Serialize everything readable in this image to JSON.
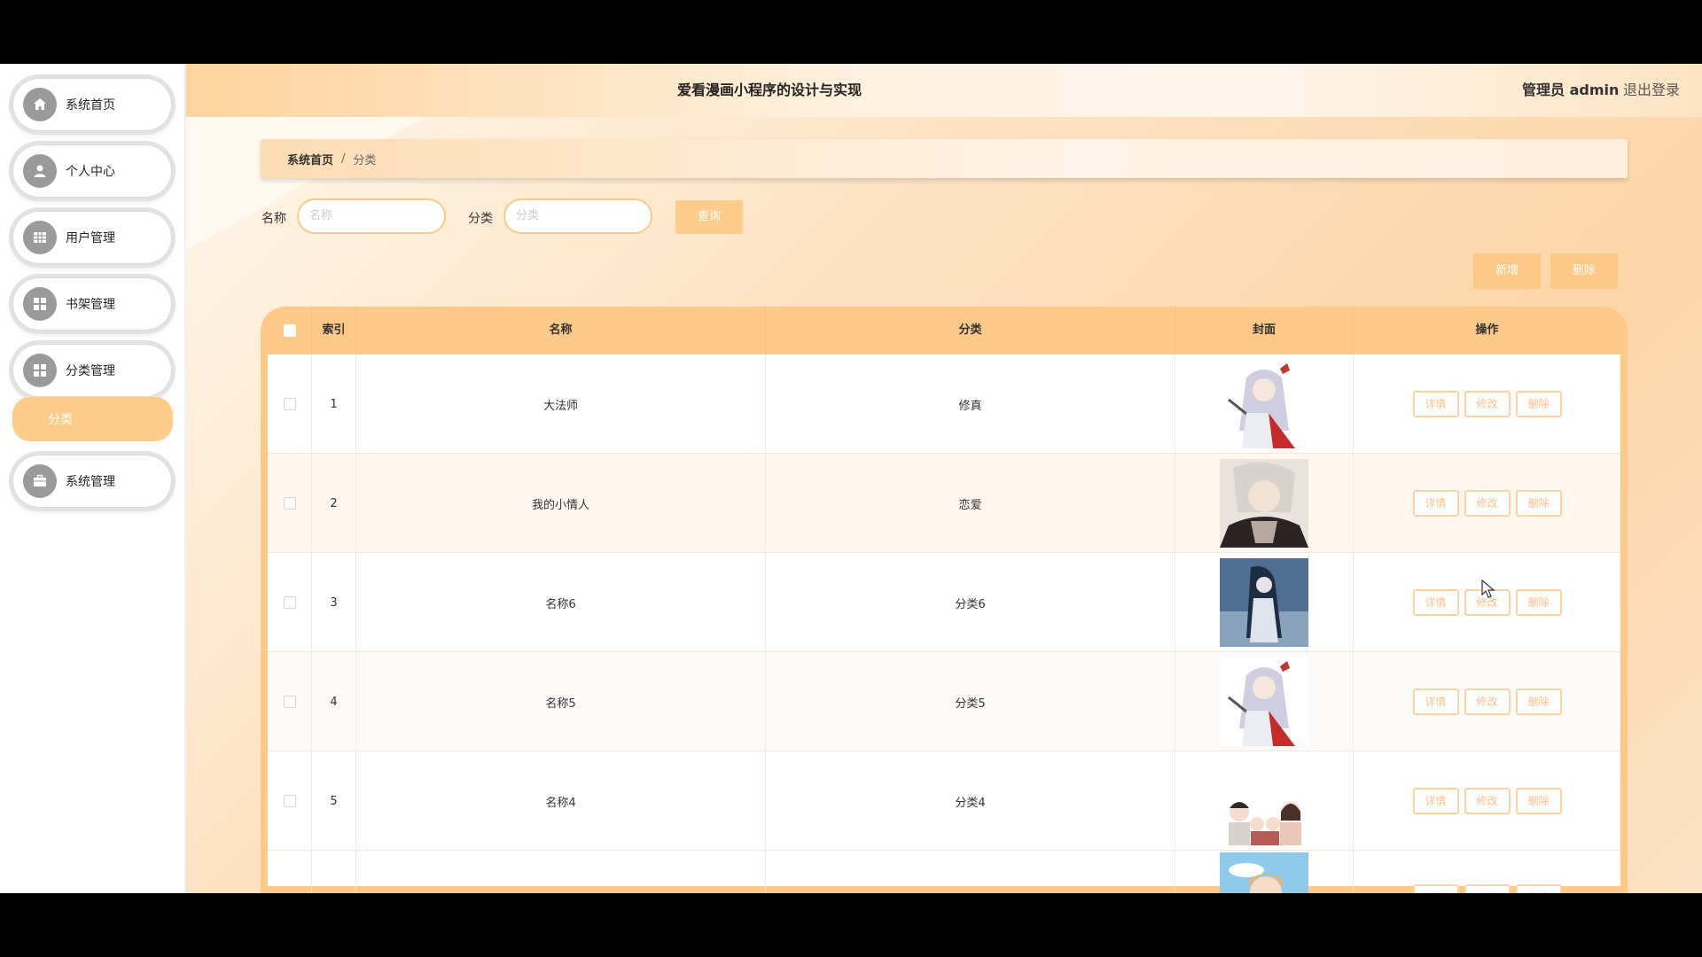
{
  "app": {
    "title": "爱看漫画小程序的设计与实现",
    "admin_label": "管理员 admin",
    "logout_label": "退出登录"
  },
  "sidebar": {
    "items": [
      {
        "label": "系统首页",
        "icon": "home-icon"
      },
      {
        "label": "个人中心",
        "icon": "user-icon"
      },
      {
        "label": "用户管理",
        "icon": "grid-icon"
      },
      {
        "label": "书架管理",
        "icon": "grid-icon"
      },
      {
        "label": "分类管理",
        "icon": "grid-icon"
      },
      {
        "label": "系统管理",
        "icon": "briefcase-icon"
      }
    ],
    "sub_item": {
      "label": "分类"
    }
  },
  "breadcrumb": {
    "home": "系统首页",
    "separator": "/",
    "current": "分类"
  },
  "filters": {
    "name_label": "名称",
    "name_placeholder": "名称",
    "category_label": "分类",
    "category_placeholder": "分类",
    "query_label": "查询"
  },
  "actions": {
    "add_label": "新增",
    "delete_label": "删除"
  },
  "table": {
    "headers": {
      "index": "索引",
      "name": "名称",
      "category": "分类",
      "cover": "封面",
      "ops": "操作"
    },
    "op_labels": {
      "detail": "详情",
      "edit": "修改",
      "delete": "删除"
    },
    "rows": [
      {
        "index": "1",
        "name": "大法师",
        "category": "修真",
        "cover": "anime-girl-sword"
      },
      {
        "index": "2",
        "name": "我的小情人",
        "category": "恋爱",
        "cover": "anime-boy-white-hair"
      },
      {
        "index": "3",
        "name": "名称6",
        "category": "分类6",
        "cover": "anime-girl-blue"
      },
      {
        "index": "4",
        "name": "名称5",
        "category": "分类5",
        "cover": "anime-girl-sword"
      },
      {
        "index": "5",
        "name": "名称4",
        "category": "分类4",
        "cover": "cartoon-family"
      }
    ]
  },
  "colors": {
    "accent": "#fdcb8a",
    "accent_dark": "#f7c184",
    "button_text": "#fdc08c"
  }
}
